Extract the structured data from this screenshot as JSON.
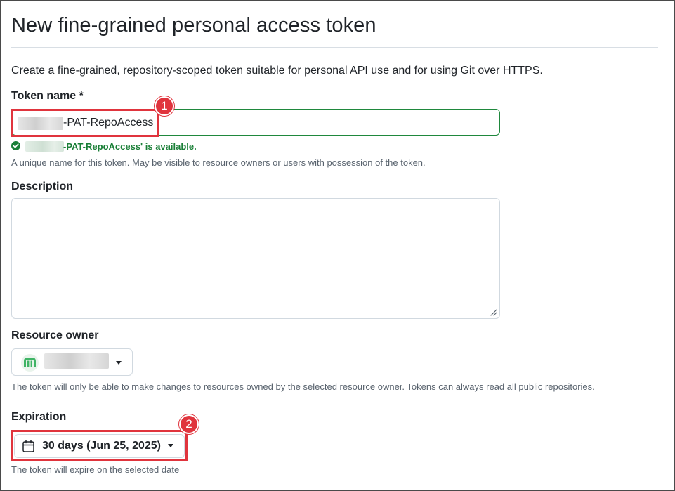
{
  "page": {
    "title": "New fine-grained personal access token",
    "intro": "Create a fine-grained, repository-scoped token suitable for personal API use and for using Git over HTTPS."
  },
  "token_name": {
    "label": "Token name *",
    "value": "-PAT-RepoAccess",
    "availability": "-PAT-RepoAccess' is available.",
    "hint": "A unique name for this token. May be visible to resource owners or users with possession of the token."
  },
  "description": {
    "label": "Description",
    "value": ""
  },
  "resource_owner": {
    "label": "Resource owner",
    "selected": "",
    "hint": "The token will only be able to make changes to resources owned by the selected resource owner. Tokens can always read all public repositories."
  },
  "expiration": {
    "label": "Expiration",
    "selected": "30 days (Jun 25, 2025)",
    "hint": "The token will expire on the selected date"
  },
  "annotations": {
    "callout_1": "1",
    "callout_2": "2",
    "color": "#e0343d"
  },
  "colors": {
    "success": "#1a7f37",
    "border": "#d1d9e0",
    "muted_text": "#59636e"
  }
}
